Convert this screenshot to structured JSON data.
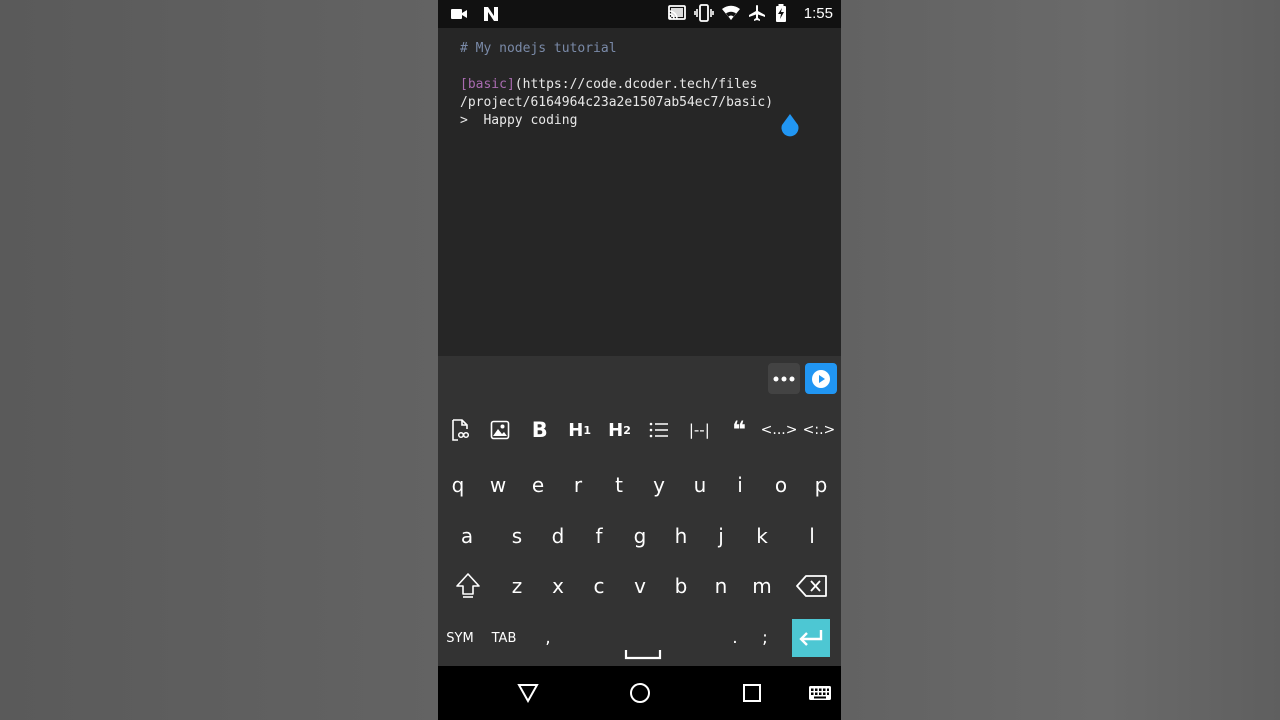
{
  "status_bar": {
    "left_icons": [
      "video-camera-icon",
      "n-app-icon"
    ],
    "right_icons": [
      "cast-icon",
      "vibrate-icon",
      "wifi-icon",
      "airplane-icon",
      "battery-charging-icon"
    ],
    "time": "1:55"
  },
  "editor": {
    "lines": [
      "# My nodejs tutorial",
      "[basic]",
      "(https://code.dcoder.tech/files",
      "/project/6164964c23a2e1507ab54ec7/basic)",
      ">  Happy coding"
    ],
    "link_text": "[basic]",
    "link_rest": "(https://code.dcoder.tech/files",
    "line_path": "/project/6164964c23a2e1507ab54ec7/basic)",
    "quote_line": ">  Happy coding",
    "heading_line": "# My nodejs tutorial"
  },
  "toolbar": {
    "more_icon": "more-dots-icon",
    "run_icon": "play-icon"
  },
  "markdown_tools": {
    "bold": "B",
    "h1": "H",
    "h1_sub": "1",
    "h2": "H",
    "h2_sub": "2",
    "hr": "|--|",
    "quote": "❝",
    "code_inline": "<...>",
    "code_block": "<:.>"
  },
  "keyboard": {
    "row1": [
      "q",
      "w",
      "e",
      "r",
      "t",
      "y",
      "u",
      "i",
      "o",
      "p"
    ],
    "row2": [
      "a",
      "s",
      "d",
      "f",
      "g",
      "h",
      "j",
      "k",
      "l"
    ],
    "row3": [
      "z",
      "x",
      "c",
      "v",
      "b",
      "n",
      "m"
    ],
    "sym": "SYM",
    "tab": "TAB",
    "comma": ",",
    "period": ".",
    "semicolon": ";"
  },
  "colors": {
    "accent_blue": "#2196f3",
    "enter_teal": "#4dc7d3",
    "link_purple": "#a96bb0",
    "heading_slate": "#7a8aa8"
  }
}
